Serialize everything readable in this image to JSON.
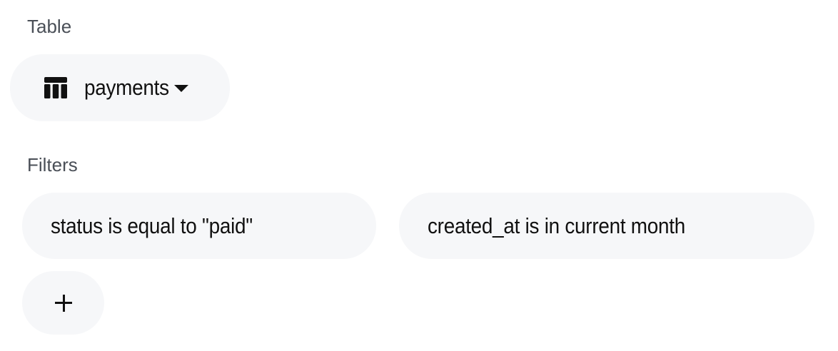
{
  "table_section": {
    "label": "Table",
    "selected_table": "payments",
    "icon": "table-icon"
  },
  "filters_section": {
    "label": "Filters",
    "filters": [
      "status is equal to \"paid\"",
      "created_at is in current month"
    ],
    "add_button_icon": "plus-icon"
  }
}
